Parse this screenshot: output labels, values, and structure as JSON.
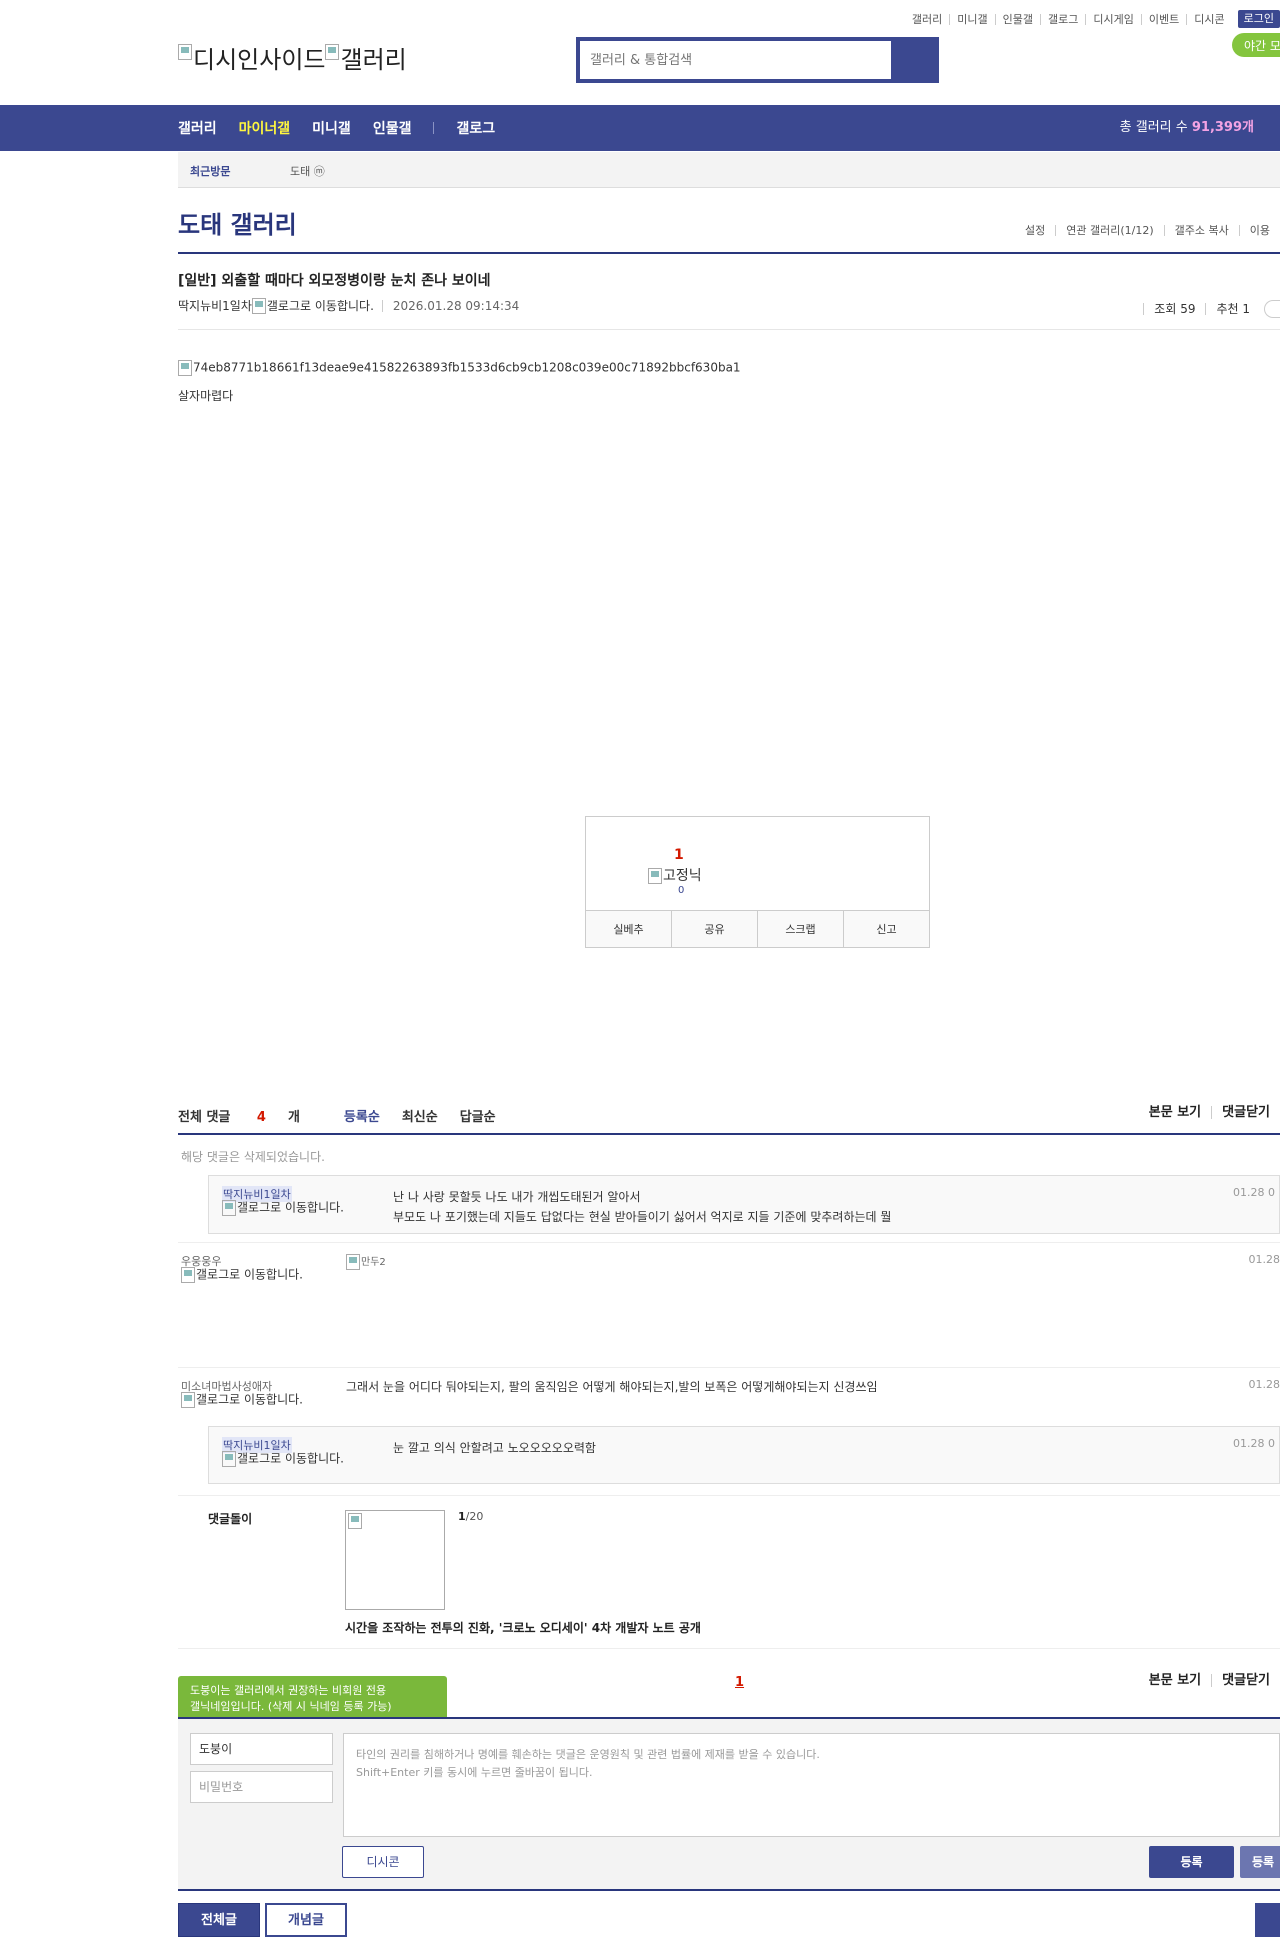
{
  "top_util": {
    "items": [
      "갤러리",
      "미니갤",
      "인물갤",
      "갤로그",
      "디시게임",
      "이벤트",
      "디시콘"
    ],
    "login": "로그인",
    "night_mode": "야간 모드"
  },
  "logo": {
    "alt1": "디시인사이드",
    "alt2": "갤러리"
  },
  "search": {
    "placeholder": "갤러리 & 통합검색"
  },
  "gnb": {
    "menu": [
      "갤러리",
      "마이너갤",
      "미니갤",
      "인물갤",
      "갤로그"
    ],
    "total_label": "총 갤러리 수 ",
    "total_value": "91,399개"
  },
  "visit": {
    "title": "최근방문",
    "gallery": "도태 ⓜ"
  },
  "gallery_title": "도태 갤러리",
  "gallery_links": [
    "설정",
    "연관 갤러리(1/12)",
    "갤주소 복사",
    "이용"
  ],
  "post": {
    "title": "[일반] 외출할 때마다 외모정병이랑 눈치 존나 보이네",
    "author": "딱지뉴비1일차",
    "gallog_alt": "갤로그로 이동합니다.",
    "date": "2026.01.28 09:14:34",
    "views": "조회 59",
    "recommend": "추천 1",
    "image_alt": "74eb8771b18661f13deae9e41582263893fb1533d6cb9cb1208c039e00c71892bbcf630ba1",
    "body": "살자마렵다"
  },
  "recommend_box": {
    "count": "1",
    "fix_alt": "고정닉",
    "fix_count": "0",
    "buttons": [
      "실베추",
      "공유",
      "스크랩",
      "신고"
    ]
  },
  "comments_header": {
    "total_label": "전체 댓글 ",
    "total_count": "4",
    "total_unit": "개",
    "sorts": [
      "등록순",
      "최신순",
      "답글순"
    ],
    "right": [
      "본문 보기",
      "댓글닫기"
    ]
  },
  "deleted_notice": "해당 댓글은 삭제되었습니다.",
  "comments": [
    {
      "type": "reply",
      "nick": "딱지뉴비1일차",
      "gallog": "갤로그로 이동합니다.",
      "lines": [
        "난 나 사랑 못할듯 나도 내가 개씹도태된거 알아서",
        "부모도 나 포기했는데 지들도 답없다는 현실 받아들이기 싫어서 억지로 지들 기준에 맞추려하는데 뭘"
      ],
      "time": "01.28 0"
    },
    {
      "type": "comment",
      "nick": "우웅웅우",
      "gallog": "갤로그로 이동합니다.",
      "image_alt": "만두2",
      "time": "01.28"
    },
    {
      "type": "comment",
      "nick": "미소녀마법사성애자",
      "gallog": "갤로그로 이동합니다.",
      "text": "그래서 눈을 어디다 둬야되는지, 팔의 움직임은 어떻게 해야되는지,발의 보폭은 어떻게해야되는지 신경쓰임",
      "time": "01.28"
    },
    {
      "type": "reply",
      "nick": "딱지뉴비1일차",
      "gallog": "갤로그로 이동합니다.",
      "lines": [
        "눈 깔고 의식 안할려고 노오오오오오력함"
      ],
      "time": "01.28 0"
    }
  ],
  "dolgul": {
    "label": "댓글돌이",
    "pager_current": "1",
    "pager_total": "/20",
    "title": "시간을 조작하는 전투의 진화, '크로노 오디세이' 4차 개발자 노트 공개"
  },
  "tooltip": {
    "line1": "도붕이는 갤러리에서 권장하는 비회원 전용",
    "line2": "갤닉네임입니다. (삭제 시 닉네임 등록 가능)"
  },
  "pagination": {
    "current": "1"
  },
  "write": {
    "nickname": "도붕이",
    "password_placeholder": "비밀번호",
    "textarea_line1": "타인의 권리를 침해하거나 명예를 훼손하는 댓글은 운영원칙 및 관련 법률에 제재를 받을 수 있습니다.",
    "textarea_line2": "Shift+Enter 키를 동시에 누르면 줄바꿈이 됩니다.",
    "dccon": "디시콘",
    "submit": "등록",
    "submit2": "등록"
  },
  "bottom_buttons": {
    "all": "전체글",
    "best": "개념글"
  }
}
